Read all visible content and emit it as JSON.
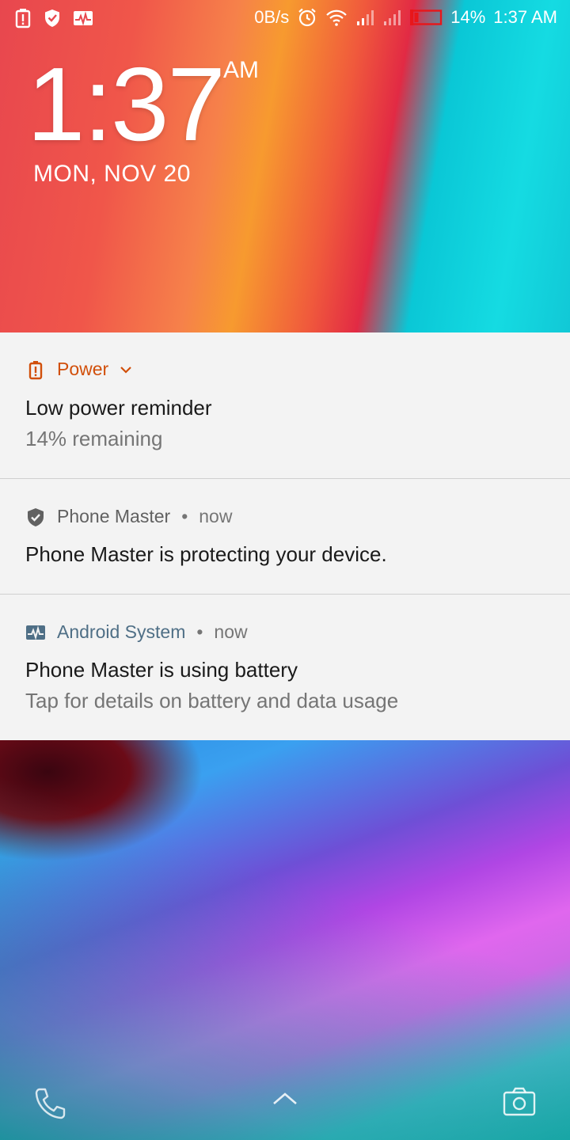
{
  "status_bar": {
    "left_icons": [
      "battery-alert-icon",
      "shield-check-icon",
      "activity-monitor-icon"
    ],
    "net_speed": "0B/s",
    "battery_percent": "14%",
    "time": "1:37 AM",
    "right_icons": [
      "alarm-icon",
      "wifi-icon",
      "signal-icon",
      "signal-weak-icon",
      "battery-low-icon"
    ]
  },
  "lockscreen": {
    "time": "1:37",
    "ampm": "AM",
    "date": "MON, NOV 20"
  },
  "notifications": [
    {
      "app": "Power",
      "title": "Low power reminder",
      "text": "14% remaining",
      "icon": "battery-alert-icon",
      "accent": "#d14f0a",
      "expandable": true
    },
    {
      "app": "Phone Master",
      "time": "now",
      "title": "Phone Master is protecting your device.",
      "icon": "shield-check-icon",
      "accent": "#616161"
    },
    {
      "app": "Android System",
      "time": "now",
      "title": "Phone Master is using battery",
      "text": "Tap for details on battery and data usage",
      "icon": "activity-monitor-icon",
      "accent": "#4f6f86"
    }
  ],
  "shortcuts": {
    "left_icon": "phone-icon",
    "center_icon": "chevron-up-icon",
    "right_icon": "camera-icon"
  },
  "colors": {
    "battery_low_red": "#e8161a",
    "panel_bg": "#f3f3f3",
    "power_accent": "#d14f0a",
    "android_system_accent": "#4f6f86"
  },
  "separator": "•"
}
